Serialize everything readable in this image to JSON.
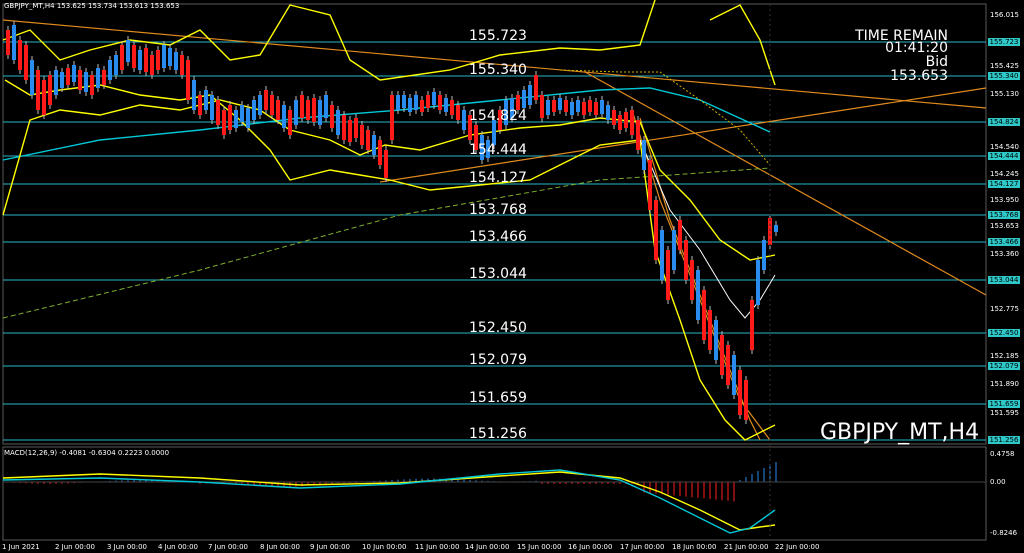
{
  "header": {
    "text": "GBPJPY_MT,H4  153.625 153.734 153.613 153.653"
  },
  "levels": [
    "155.723",
    "155.340",
    "154.824",
    "154.444",
    "154.127",
    "153.768",
    "153.466",
    "153.044",
    "152.450",
    "152.079",
    "151.659",
    "151.256"
  ],
  "right_axis": [
    "156.015",
    "155.723",
    "155.425",
    "155.340",
    "155.130",
    "154.824",
    "154.540",
    "154.444",
    "154.245",
    "154.127",
    "153.950",
    "153.768",
    "153.653",
    "153.466",
    "153.360",
    "153.044",
    "152.775",
    "152.450",
    "152.185",
    "152.079",
    "151.890",
    "151.659",
    "151.595",
    "151.256"
  ],
  "time_remain": {
    "label": "TIME REMAIN",
    "value": "01:41:20",
    "bid_label": "Bid",
    "bid_value": "153.653"
  },
  "symbol_label": "GBPJPY_MT,H4",
  "macd": {
    "header": "MACD(12,26,9) -0.4081 -0.6304 0.2223 0.0000",
    "axis": [
      "0.4758",
      "0.00",
      "-0.8246"
    ]
  },
  "x_labels": [
    "1 Jun 2021",
    "2 Jun 00:00",
    "3 Jun 00:00",
    "4 Jun 00:00",
    "7 Jun 00:00",
    "8 Jun 00:00",
    "9 Jun 00:00",
    "10 Jun 00:00",
    "11 Jun 00:00",
    "14 Jun 00:00",
    "15 Jun 00:00",
    "16 Jun 00:00",
    "17 Jun 00:00",
    "18 Jun 00:00",
    "21 Jun 00:00",
    "22 Jun 00:00"
  ],
  "colors": {
    "bull": "#2b8cf0",
    "bear": "#ff1a1a",
    "level": "#29b6c6",
    "band": "#ffff00",
    "trend": "#e08a1e",
    "ma": "#00c8d8"
  }
}
